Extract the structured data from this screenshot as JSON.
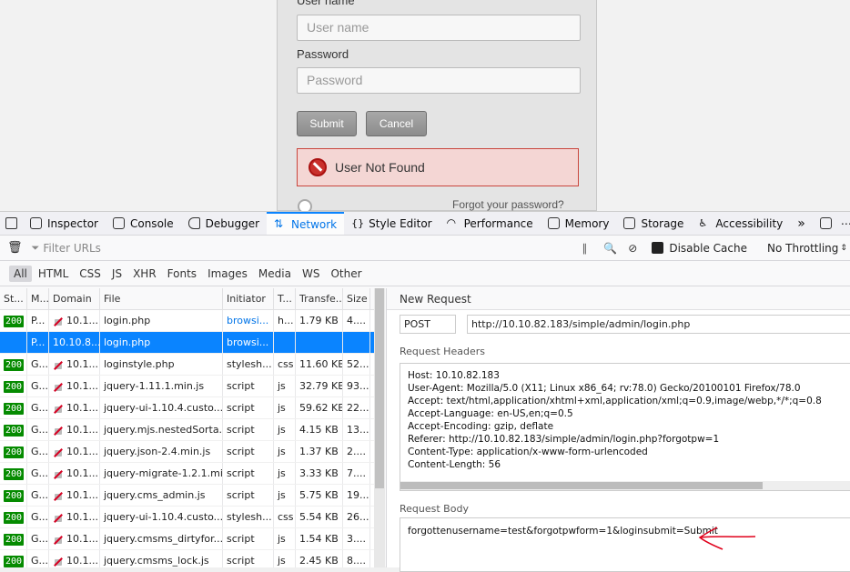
{
  "login": {
    "username_label": "User name",
    "username_placeholder": "User name",
    "password_label": "Password",
    "password_placeholder": "Password",
    "submit_label": "Submit",
    "cancel_label": "Cancel",
    "error_message": "User Not Found",
    "forgot_link": "Forgot your password?"
  },
  "devtools": {
    "tabs": [
      {
        "label": "Inspector",
        "icon": "inspector-icon"
      },
      {
        "label": "Console",
        "icon": "console-icon"
      },
      {
        "label": "Debugger",
        "icon": "debugger-icon"
      },
      {
        "label": "Network",
        "icon": "network-icon"
      },
      {
        "label": "Style Editor",
        "icon": "style-editor-icon"
      },
      {
        "label": "Performance",
        "icon": "performance-icon"
      },
      {
        "label": "Memory",
        "icon": "memory-icon"
      },
      {
        "label": "Storage",
        "icon": "storage-icon"
      },
      {
        "label": "Accessibility",
        "icon": "accessibility-icon"
      }
    ],
    "active_tab": "Network",
    "filter_placeholder": "Filter URLs",
    "disable_cache_label": "Disable Cache",
    "throttling_label": "No Throttling",
    "type_filters": [
      "All",
      "HTML",
      "CSS",
      "JS",
      "XHR",
      "Fonts",
      "Images",
      "Media",
      "WS",
      "Other"
    ],
    "active_filter": "All",
    "columns": [
      "St...",
      "M...",
      "Domain",
      "File",
      "Initiator",
      "T...",
      "Transfe...",
      "Size"
    ],
    "requests": [
      {
        "status": "200",
        "method": "P...",
        "domain": "10.1...",
        "file": "login.php",
        "initiator": "browsi...",
        "type": "h...",
        "transferred": "1.79 KB",
        "size": "4....",
        "selected": false
      },
      {
        "status": "",
        "method": "P...",
        "domain": "10.10.8...",
        "file": "login.php",
        "initiator": "browsi...",
        "type": "",
        "transferred": "",
        "size": "",
        "selected": true
      },
      {
        "status": "200",
        "method": "G...",
        "domain": "10.1...",
        "file": "loginstyle.php",
        "initiator": "stylesh...",
        "type": "css",
        "transferred": "11.60 KB",
        "size": "52...",
        "selected": false
      },
      {
        "status": "200",
        "method": "G...",
        "domain": "10.1...",
        "file": "jquery-1.11.1.min.js",
        "initiator": "script",
        "type": "js",
        "transferred": "32.79 KB",
        "size": "93...",
        "selected": false
      },
      {
        "status": "200",
        "method": "G...",
        "domain": "10.1...",
        "file": "jquery-ui-1.10.4.custo...",
        "initiator": "script",
        "type": "js",
        "transferred": "59.62 KB",
        "size": "22...",
        "selected": false
      },
      {
        "status": "200",
        "method": "G...",
        "domain": "10.1...",
        "file": "jquery.mjs.nestedSorta...",
        "initiator": "script",
        "type": "js",
        "transferred": "4.15 KB",
        "size": "13...",
        "selected": false
      },
      {
        "status": "200",
        "method": "G...",
        "domain": "10.1...",
        "file": "jquery.json-2.4.min.js",
        "initiator": "script",
        "type": "js",
        "transferred": "1.37 KB",
        "size": "2....",
        "selected": false
      },
      {
        "status": "200",
        "method": "G...",
        "domain": "10.1...",
        "file": "jquery-migrate-1.2.1.mi...",
        "initiator": "script",
        "type": "js",
        "transferred": "3.33 KB",
        "size": "7....",
        "selected": false
      },
      {
        "status": "200",
        "method": "G...",
        "domain": "10.1...",
        "file": "jquery.cms_admin.js",
        "initiator": "script",
        "type": "js",
        "transferred": "5.75 KB",
        "size": "19...",
        "selected": false
      },
      {
        "status": "200",
        "method": "G...",
        "domain": "10.1...",
        "file": "jquery-ui-1.10.4.custo...",
        "initiator": "stylesh...",
        "type": "css",
        "transferred": "5.54 KB",
        "size": "26...",
        "selected": false
      },
      {
        "status": "200",
        "method": "G...",
        "domain": "10.1...",
        "file": "jquery.cmsms_dirtyfor...",
        "initiator": "script",
        "type": "js",
        "transferred": "1.54 KB",
        "size": "3....",
        "selected": false
      },
      {
        "status": "200",
        "method": "G...",
        "domain": "10.1...",
        "file": "jquery.cmsms_lock.js",
        "initiator": "script",
        "type": "js",
        "transferred": "2.45 KB",
        "size": "8....",
        "selected": false
      }
    ],
    "details": {
      "title": "New Request",
      "method": "POST",
      "url": "http://10.10.82.183/simple/admin/login.php",
      "headers_label": "Request Headers",
      "headers": "Host: 10.10.82.183\nUser-Agent: Mozilla/5.0 (X11; Linux x86_64; rv:78.0) Gecko/20100101 Firefox/78.0\nAccept: text/html,application/xhtml+xml,application/xml;q=0.9,image/webp,*/*;q=0.8\nAccept-Language: en-US,en;q=0.5\nAccept-Encoding: gzip, deflate\nReferer: http://10.10.82.183/simple/admin/login.php?forgotpw=1\nContent-Type: application/x-www-form-urlencoded\nContent-Length: 56",
      "body_label": "Request Body",
      "body": "forgottenusername=test&forgotpwform=1&loginsubmit=Submit"
    }
  },
  "colors": {
    "accent": "#0a84ff",
    "status_ok": "#058b00",
    "error_bg": "#f4d6d4",
    "annotation": "#e0001b"
  }
}
